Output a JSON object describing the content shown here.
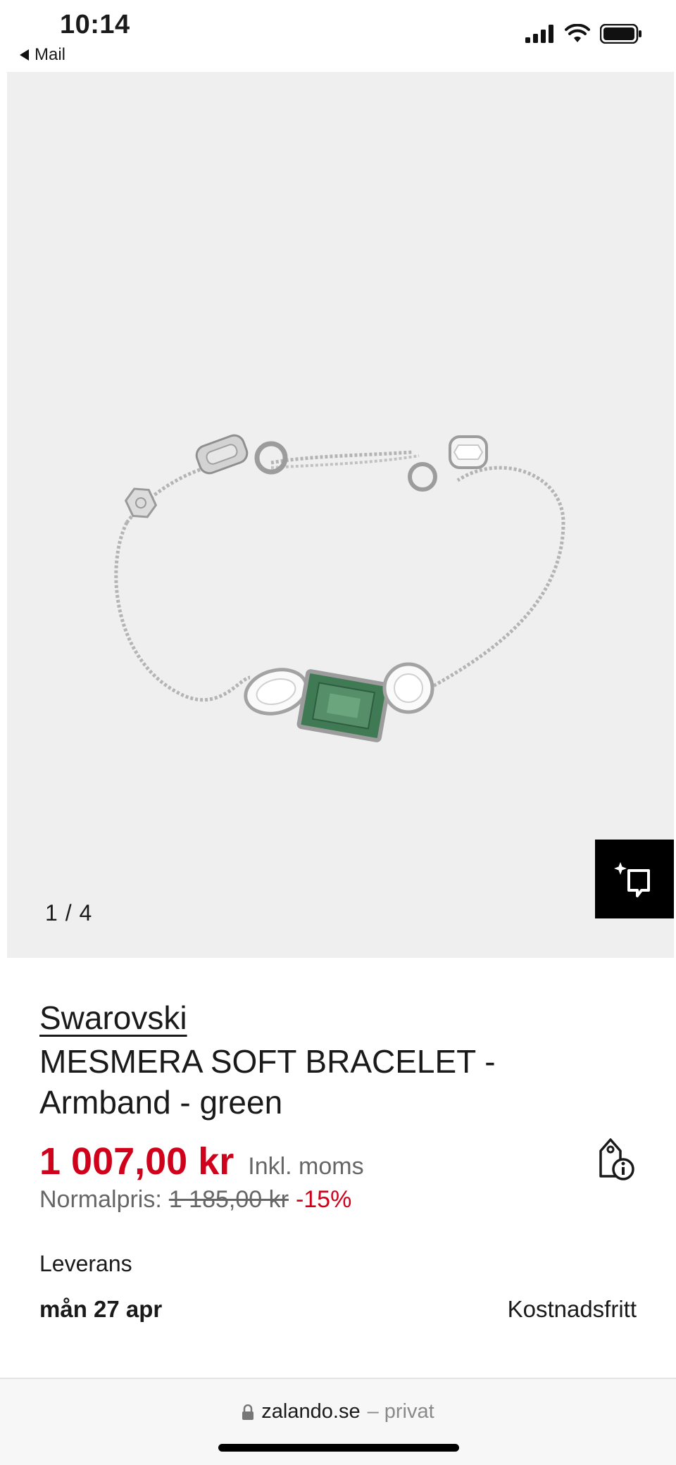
{
  "status_bar": {
    "time": "10:14",
    "back_label": "Mail"
  },
  "gallery": {
    "counter": "1 / 4",
    "image_alt": "bracelet-product-image"
  },
  "product": {
    "brand": "Swarovski",
    "title": "MESMERA SOFT BRACELET - Armband - green",
    "price": "1 007,00 kr",
    "vat_note": "Inkl. moms",
    "normal_label": "Normalpris:",
    "old_price": "1 185,00 kr",
    "discount": "-15%"
  },
  "delivery": {
    "label": "Leverans",
    "date": "mån 27 apr",
    "cost": "Kostnadsfritt"
  },
  "browser": {
    "domain": "zalando.se",
    "mode": "– privat"
  },
  "colors": {
    "price_red": "#d0021b",
    "gallery_bg": "#efefef",
    "emerald": "#3f7a55"
  }
}
